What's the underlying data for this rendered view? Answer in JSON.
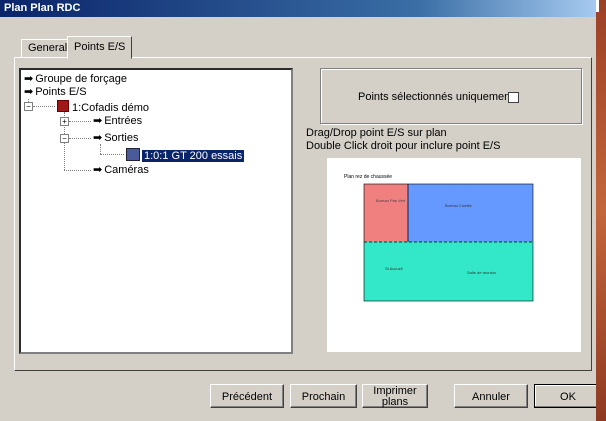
{
  "window": {
    "title": "Plan Plan RDC"
  },
  "tabs": [
    {
      "label": "General"
    },
    {
      "label": "Points E/S"
    }
  ],
  "tree": {
    "nodes": [
      {
        "label": "Groupe de forçage"
      },
      {
        "label": "Points E/S"
      },
      {
        "label": "1:Cofadis démo"
      },
      {
        "label": "Entrées"
      },
      {
        "label": "Sorties"
      },
      {
        "label": "1:0:1  GT 200 essais"
      },
      {
        "label": "Caméras"
      }
    ]
  },
  "options": {
    "selected_only_label": "Points sélectionnés uniquement",
    "selected_only_checked": false
  },
  "hints": {
    "line1": "Drag/Drop point E/S sur plan",
    "line2": "Double Click droit pour inclure point E/S"
  },
  "plan": {
    "title": "Plan rez de chaussée",
    "rooms": [
      {
        "label": "Bureau Pas Vert",
        "color": "#f08080"
      },
      {
        "label": "Bureau Comité",
        "color": "#6699ff"
      },
      {
        "label": "St Accueil",
        "color": "#33e8c8"
      },
      {
        "label": "Salle de réunion",
        "color": "#33e8c8"
      }
    ]
  },
  "buttons": {
    "previous": "Précédent",
    "next": "Prochain",
    "print": "Imprimer plans",
    "cancel": "Annuler",
    "ok": "OK"
  }
}
